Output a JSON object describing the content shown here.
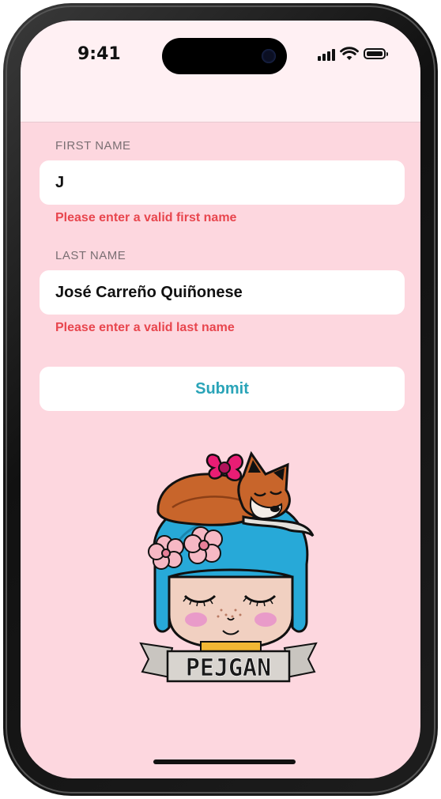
{
  "status_bar": {
    "time": "9:41"
  },
  "form": {
    "first_name": {
      "label": "FIRST NAME",
      "value": "J",
      "error": "Please enter a valid first name"
    },
    "last_name": {
      "label": "LAST NAME",
      "value": "José Carreño Quiñonese",
      "error": "Please enter a valid last name"
    },
    "submit_label": "Submit"
  },
  "logo": {
    "text": "PEJGAN"
  },
  "colors": {
    "background": "#fdd7df",
    "error": "#e8464e",
    "accent": "#2aa4b8"
  }
}
